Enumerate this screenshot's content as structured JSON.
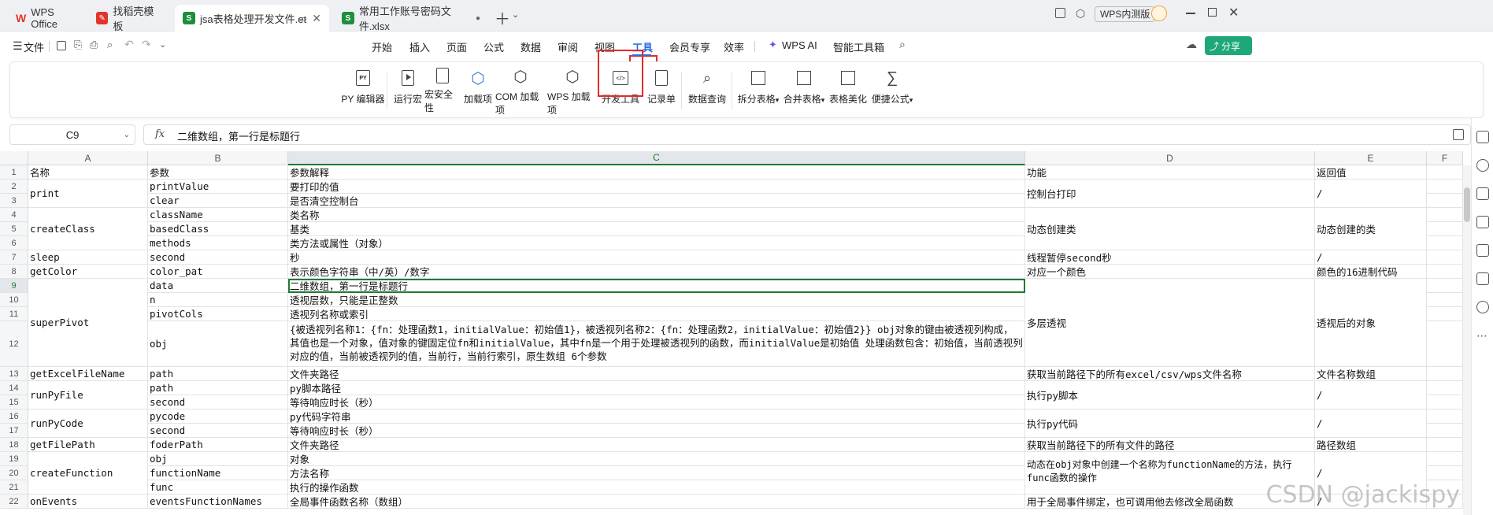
{
  "tabs": [
    {
      "label": "WPS Office",
      "icon": "wps-logo-icon",
      "color": "#e1352a"
    },
    {
      "label": "找稻壳模板",
      "icon": "docer-icon",
      "color": "#e1352a"
    },
    {
      "label": "jsa表格处理开发文件.et",
      "icon": "spreadsheet-icon",
      "color": "#1e8e3e",
      "active": true
    },
    {
      "label": "常用工作账号密码文件.xlsx",
      "icon": "spreadsheet-icon",
      "color": "#1e8e3e"
    }
  ],
  "tab_icon_letter": "S",
  "window": {
    "badge": "WPS内测版"
  },
  "menubar": {
    "file_label": "文件",
    "items": [
      "开始",
      "插入",
      "页面",
      "公式",
      "数据",
      "审阅",
      "视图",
      "工具",
      "会员专享",
      "效率",
      "WPS AI",
      "智能工具箱"
    ],
    "active": "工具",
    "share_label": "分享"
  },
  "ribbon": {
    "items": [
      {
        "label": "PY 编辑器",
        "icon": "py-editor-icon"
      },
      {
        "label": "运行宏",
        "icon": "run-macro-icon"
      },
      {
        "label": "宏安全性",
        "icon": "macro-security-icon"
      },
      {
        "label": "加载项",
        "icon": "addin-icon"
      },
      {
        "label": "COM 加载项",
        "icon": "com-addin-icon"
      },
      {
        "label": "WPS 加载项",
        "icon": "wps-addin-icon"
      },
      {
        "label": "开发工具",
        "icon": "developer-tools-icon",
        "highlight": true
      },
      {
        "label": "记录单",
        "icon": "record-form-icon"
      },
      {
        "label": "数据查询",
        "icon": "data-query-icon"
      },
      {
        "label": "拆分表格",
        "icon": "split-table-icon",
        "dropdown": true
      },
      {
        "label": "合并表格",
        "icon": "merge-table-icon",
        "dropdown": true
      },
      {
        "label": "表格美化",
        "icon": "table-beautify-icon"
      },
      {
        "label": "便捷公式",
        "icon": "quick-formula-icon",
        "dropdown": true
      }
    ],
    "py_badge": "PY"
  },
  "formula_bar": {
    "name_box": "C9",
    "fx_label": "fx",
    "value": "二维数组，第一行是标题行"
  },
  "columns": [
    "A",
    "B",
    "C",
    "D",
    "E",
    "F"
  ],
  "selected_column": "C",
  "selected_row": "9",
  "rows": [
    "1",
    "2",
    "3",
    "4",
    "5",
    "6",
    "7",
    "8",
    "9",
    "10",
    "11",
    "12",
    "13",
    "14",
    "15",
    "16",
    "17",
    "18",
    "19",
    "20",
    "21",
    "22"
  ],
  "cells": {
    "A": [
      {
        "r": "1",
        "text": "名称"
      },
      {
        "r": "2-3",
        "text": "print"
      },
      {
        "r": "4-6",
        "text": "createClass"
      },
      {
        "r": "7",
        "text": "sleep"
      },
      {
        "r": "8",
        "text": "getColor"
      },
      {
        "r": "9-12",
        "text": "superPivot"
      },
      {
        "r": "13",
        "text": "getExcelFileName"
      },
      {
        "r": "14-15",
        "text": "runPyFile"
      },
      {
        "r": "16-17",
        "text": "runPyCode"
      },
      {
        "r": "18",
        "text": "getFilePath"
      },
      {
        "r": "19-21",
        "text": "createFunction"
      },
      {
        "r": "22",
        "text": "onEvents"
      }
    ],
    "B": [
      {
        "r": "1",
        "text": "参数"
      },
      {
        "r": "2",
        "text": "printValue"
      },
      {
        "r": "3",
        "text": "clear"
      },
      {
        "r": "4",
        "text": "className"
      },
      {
        "r": "5",
        "text": "basedClass"
      },
      {
        "r": "6",
        "text": "methods"
      },
      {
        "r": "7",
        "text": "second"
      },
      {
        "r": "8",
        "text": "color_pat"
      },
      {
        "r": "9",
        "text": "data"
      },
      {
        "r": "10",
        "text": "n"
      },
      {
        "r": "11",
        "text": "pivotCols"
      },
      {
        "r": "12",
        "text": "obj"
      },
      {
        "r": "13",
        "text": "path"
      },
      {
        "r": "14",
        "text": "path"
      },
      {
        "r": "15",
        "text": "second"
      },
      {
        "r": "16",
        "text": "pycode"
      },
      {
        "r": "17",
        "text": "second"
      },
      {
        "r": "18",
        "text": "foderPath"
      },
      {
        "r": "19",
        "text": "obj"
      },
      {
        "r": "20",
        "text": "functionName"
      },
      {
        "r": "21",
        "text": "func"
      },
      {
        "r": "22",
        "text": "eventsFunctionNames"
      }
    ],
    "C": [
      {
        "r": "1",
        "text": "参数解释"
      },
      {
        "r": "2",
        "text": "要打印的值"
      },
      {
        "r": "3",
        "text": "是否清空控制台"
      },
      {
        "r": "4",
        "text": "类名称"
      },
      {
        "r": "5",
        "text": "基类"
      },
      {
        "r": "6",
        "text": "类方法或属性（对象）"
      },
      {
        "r": "7",
        "text": "秒"
      },
      {
        "r": "8",
        "text": "表示颜色字符串（中/英）/数字"
      },
      {
        "r": "9",
        "text": "二维数组，第一行是标题行"
      },
      {
        "r": "10",
        "text": "透视层数，只能是正整数"
      },
      {
        "r": "11",
        "text": "透视列名称或索引"
      },
      {
        "r": "12",
        "text": "{被透视列名称1：{fn：处理函数1，initialValue：初始值1}，被透视列名称2：{fn：处理函数2，initialValue：初始值2}} obj对象的键由被透视列构成，其值也是一个对象，值对象的键固定位fn和initialValue，其中fn是一个用于处理被透视列的函数，而initialValue是初始值 处理函数包含：初始值，当前透视列对应的值，当前被透视列的值，当前行，当前行索引，原生数组 6个参数"
      },
      {
        "r": "13",
        "text": "文件夹路径"
      },
      {
        "r": "14",
        "text": "py脚本路径"
      },
      {
        "r": "15",
        "text": "等待响应时长（秒）"
      },
      {
        "r": "16",
        "text": "py代码字符串"
      },
      {
        "r": "17",
        "text": "等待响应时长（秒）"
      },
      {
        "r": "18",
        "text": "文件夹路径"
      },
      {
        "r": "19",
        "text": "对象"
      },
      {
        "r": "20",
        "text": "方法名称"
      },
      {
        "r": "21",
        "text": "执行的操作函数"
      },
      {
        "r": "22",
        "text": "全局事件函数名称（数组）"
      }
    ],
    "D": [
      {
        "r": "1",
        "text": "功能"
      },
      {
        "r": "2-3",
        "text": "控制台打印"
      },
      {
        "r": "4-6",
        "text": "动态创建类"
      },
      {
        "r": "7",
        "text": "线程暂停second秒"
      },
      {
        "r": "8",
        "text": "对应一个颜色"
      },
      {
        "r": "9-12",
        "text": "多层透视"
      },
      {
        "r": "13",
        "text": "获取当前路径下的所有excel/csv/wps文件名称"
      },
      {
        "r": "14-15",
        "text": "执行py脚本"
      },
      {
        "r": "16-17",
        "text": "执行py代码"
      },
      {
        "r": "18",
        "text": "获取当前路径下的所有文件的路径"
      },
      {
        "r": "19-21",
        "text": "动态在obj对象中创建一个名称为functionName的方法，执行func函数的操作"
      },
      {
        "r": "22",
        "text": "用于全局事件绑定，也可调用他去修改全局函数"
      }
    ],
    "E": [
      {
        "r": "1",
        "text": "返回值"
      },
      {
        "r": "2-3",
        "text": "/"
      },
      {
        "r": "4-6",
        "text": "动态创建的类"
      },
      {
        "r": "7",
        "text": "/"
      },
      {
        "r": "8",
        "text": "颜色的16进制代码"
      },
      {
        "r": "9-12",
        "text": "透视后的对象"
      },
      {
        "r": "13",
        "text": "文件名称数组"
      },
      {
        "r": "14-15",
        "text": "/"
      },
      {
        "r": "16-17",
        "text": "/"
      },
      {
        "r": "18",
        "text": "路径数组"
      },
      {
        "r": "19-21",
        "text": "/"
      },
      {
        "r": "22",
        "text": "/"
      }
    ]
  },
  "watermark": "CSDN @jackispy",
  "colors": {
    "accent": "#2a6de4",
    "highlight_box": "#e32a2a",
    "selection": "#1e7b35"
  }
}
